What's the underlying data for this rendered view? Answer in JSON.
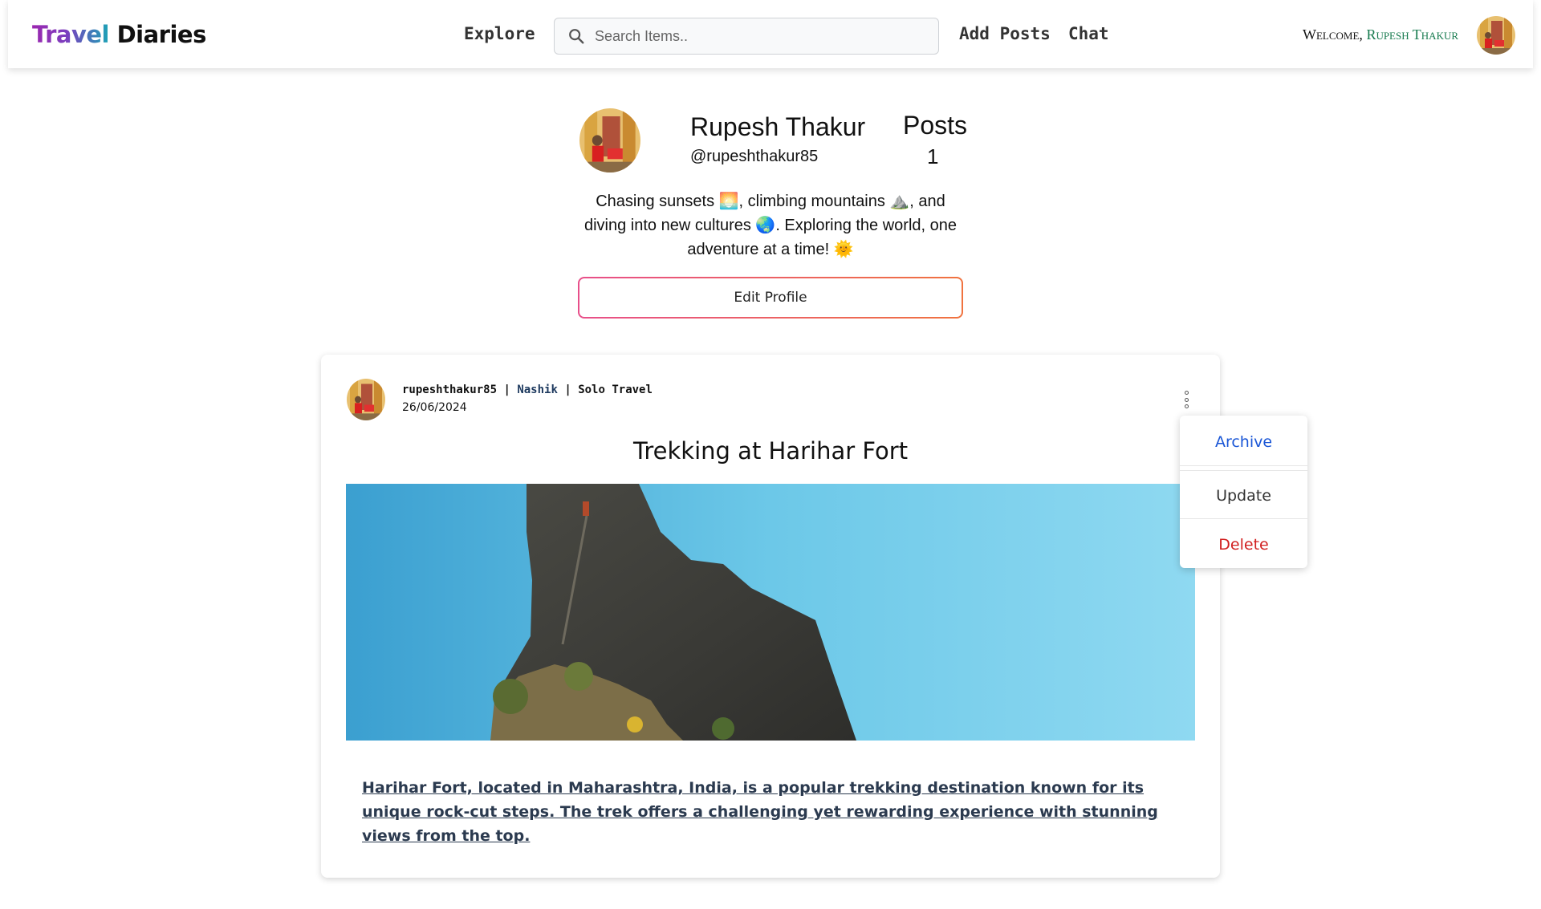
{
  "navbar": {
    "logo_part1": "Travel",
    "logo_part2": "Diaries",
    "explore_label": "Explore",
    "search_placeholder": "Search Items..",
    "add_posts_label": "Add Posts",
    "chat_label": "Chat",
    "welcome_prefix": "Welcome, ",
    "welcome_name": "Rupesh Thakur"
  },
  "profile": {
    "name": "Rupesh Thakur",
    "handle": "@rupeshthakur85",
    "posts_label": "Posts",
    "posts_count": "1",
    "bio": "Chasing sunsets 🌅, climbing mountains ⛰️, and diving into new cultures 🌏. Exploring the world, one adventure at a time! 🌞",
    "edit_button": "Edit Profile"
  },
  "post": {
    "username": "rupeshthakur85",
    "separator": " | ",
    "location": "Nashik",
    "category": "Solo Travel",
    "date": "26/06/2024",
    "title": "Trekking at Harihar Fort",
    "description": "Harihar Fort, located in Maharashtra, India, is a popular trekking destination known for its unique rock-cut steps. The trek offers a challenging yet rewarding experience with stunning views from the top."
  },
  "menu": {
    "items": [
      {
        "label": "Archive",
        "color": "#1a56d6"
      },
      {
        "label": "Update",
        "color": "#333333"
      },
      {
        "label": "Delete",
        "color": "#d11f1f"
      }
    ]
  },
  "icons": {
    "search": "search-icon",
    "more": "more-vertical-icon"
  }
}
